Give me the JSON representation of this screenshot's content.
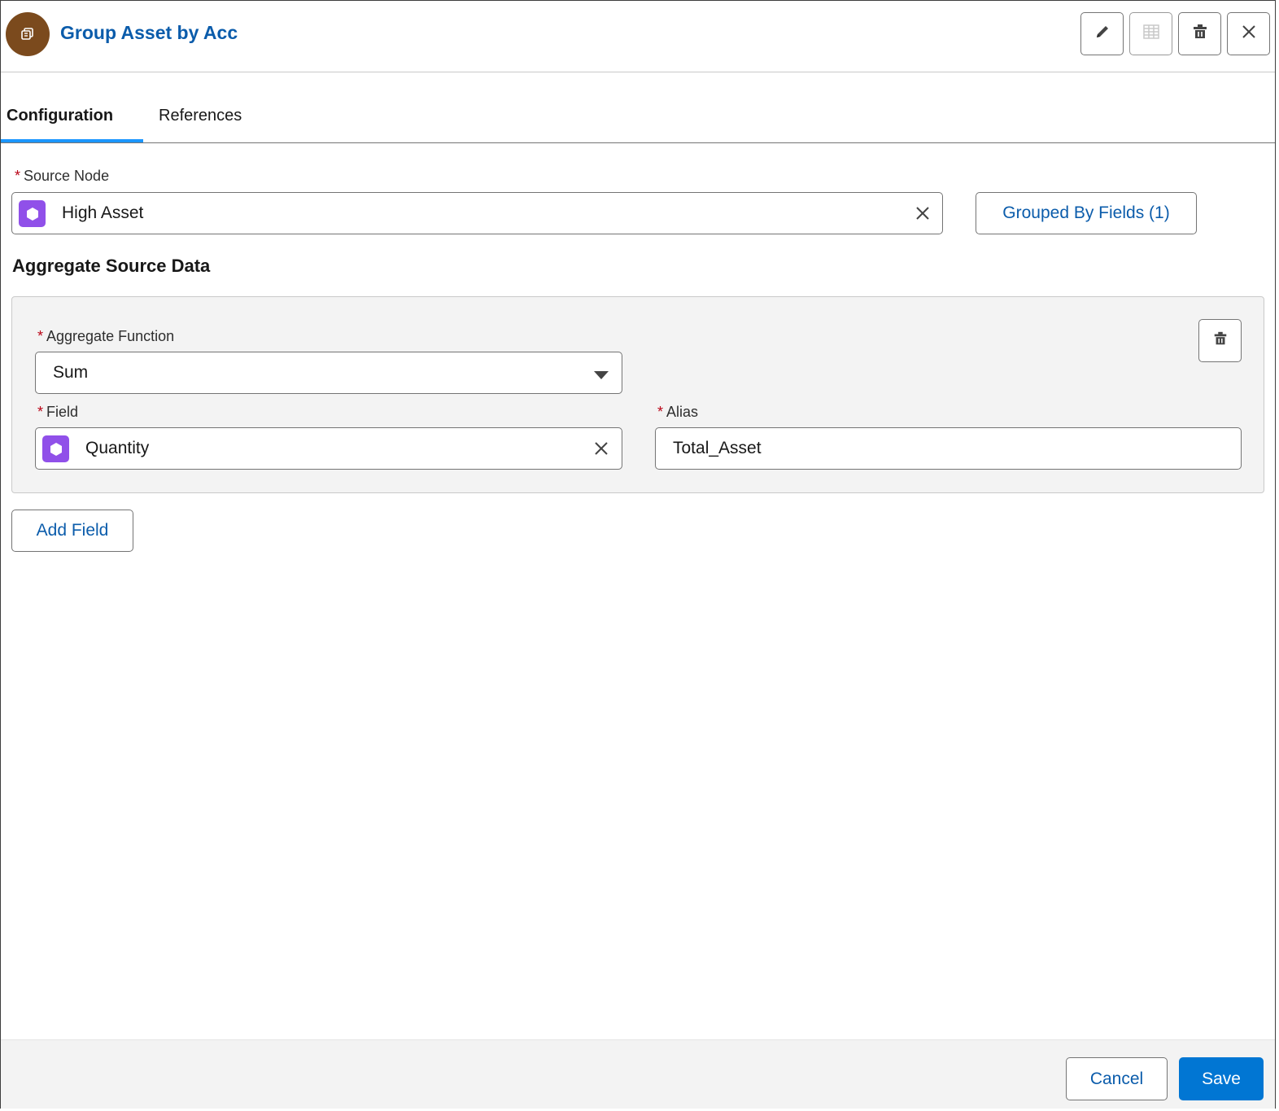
{
  "header": {
    "title": "Group Asset by Acc",
    "node_icon": "aggregate-node-icon",
    "actions": [
      {
        "name": "edit",
        "icon": "pencil-icon"
      },
      {
        "name": "preview-data",
        "icon": "table-icon",
        "disabled": true
      },
      {
        "name": "delete",
        "icon": "trash-icon"
      },
      {
        "name": "close",
        "icon": "close-icon"
      }
    ]
  },
  "tabs": {
    "configuration": "Configuration",
    "references": "References",
    "active": "configuration"
  },
  "source_node": {
    "label": "Source Node",
    "required_mark": "*",
    "value": "High Asset",
    "grouped_by_button": "Grouped By Fields (1)"
  },
  "aggregate": {
    "heading": "Aggregate Source Data",
    "function_label": "Aggregate Function",
    "function_value": "Sum",
    "field_label": "Field",
    "field_value": "Quantity",
    "alias_label": "Alias",
    "alias_value": "Total_Asset",
    "add_field_button": "Add Field"
  },
  "footer": {
    "cancel": "Cancel",
    "save": "Save"
  },
  "colors": {
    "brand": "#0176d3",
    "link": "#0b5cab",
    "node_avatar": "#7b4a1d",
    "field_badge": "#9050e9",
    "required": "#ba0517"
  }
}
